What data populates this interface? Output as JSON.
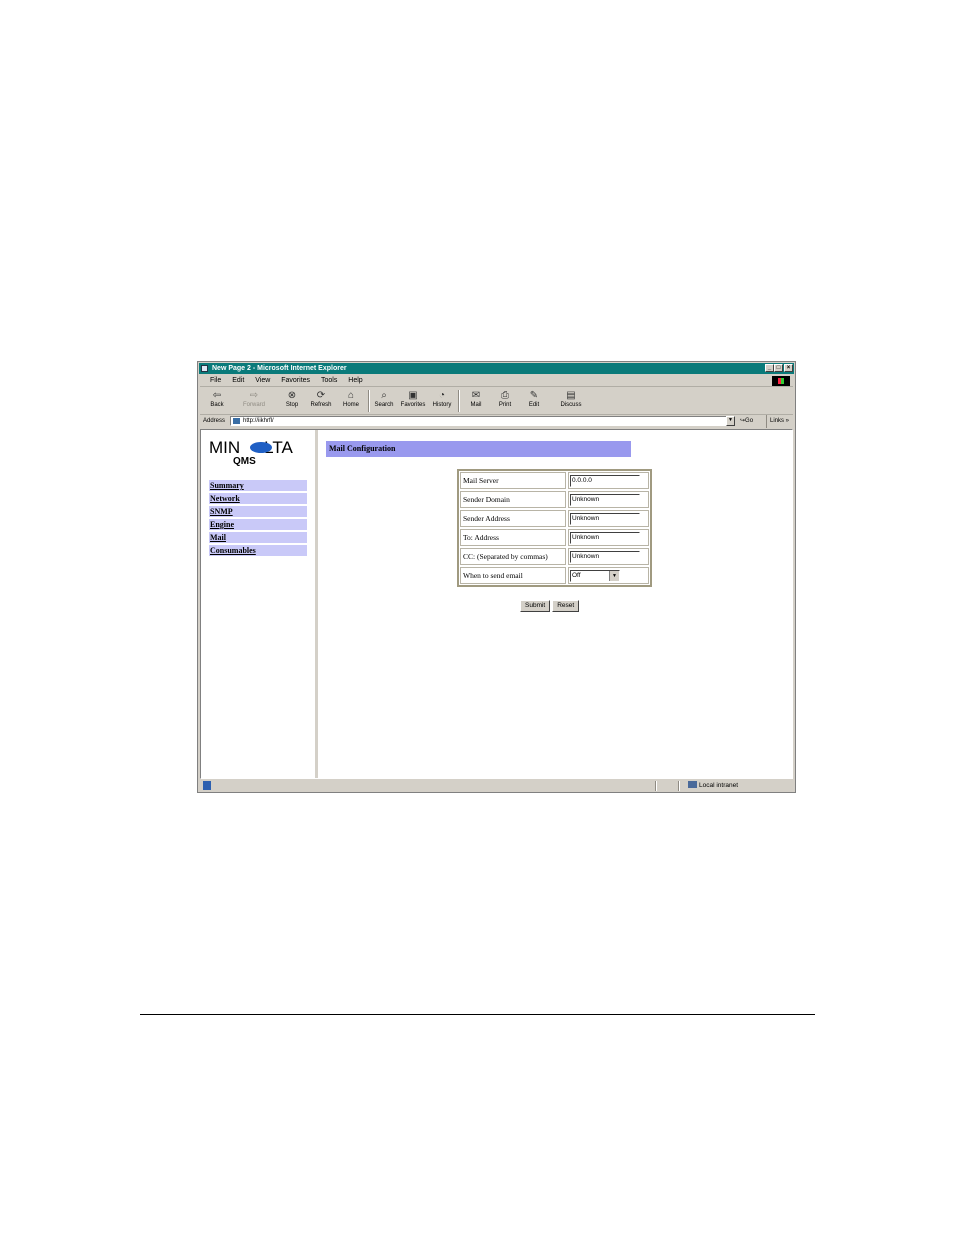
{
  "window": {
    "title": "New Page 2 - Microsoft Internet Explorer",
    "controls": [
      "_",
      "□",
      "×"
    ]
  },
  "menu": [
    "File",
    "Edit",
    "View",
    "Favorites",
    "Tools",
    "Help"
  ],
  "toolbar": {
    "back": "Back",
    "forward": "Forward",
    "stop": "Stop",
    "refresh": "Refresh",
    "home": "Home",
    "search": "Search",
    "favorites": "Favorites",
    "history": "History",
    "mail": "Mail",
    "print": "Print",
    "edit": "Edit",
    "discuss": "Discuss"
  },
  "address": {
    "label": "Address",
    "url": "http://iikhrfl/",
    "go": "Go",
    "links": "Links"
  },
  "logo": {
    "brand": "MINOLTA",
    "brand_left": "MIN",
    "brand_right": "LTA",
    "sub": "QMS"
  },
  "nav": [
    "Summary",
    "Network",
    "SNMP",
    "Engine",
    "Mail",
    "Consumables"
  ],
  "page": {
    "heading": "Mail Configuration",
    "fields": [
      {
        "label": "Mail Server",
        "value": "0.0.0.0"
      },
      {
        "label": "Sender Domain",
        "value": "Unknown"
      },
      {
        "label": "Sender Address",
        "value": "Unknown"
      },
      {
        "label": "To: Address",
        "value": "Unknown"
      },
      {
        "label": "CC: (Separated by commas)",
        "value": "Unknown"
      },
      {
        "label": "When to send email",
        "value": "Off"
      }
    ],
    "submit": "Submit",
    "reset": "Reset"
  },
  "status": {
    "zone": "Local intranet"
  }
}
